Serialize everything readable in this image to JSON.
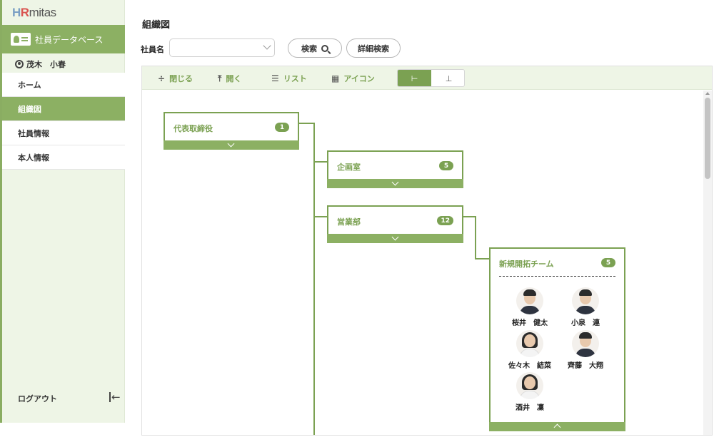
{
  "sidebar": {
    "logo": {
      "h": "H",
      "r": "R",
      "rest": "mitas"
    },
    "database_label": "社員データベース",
    "user_name": "茂木　小春",
    "nav": [
      {
        "label": "ホーム"
      },
      {
        "label": "組織図"
      },
      {
        "label": "社員情報"
      },
      {
        "label": "本人情報"
      }
    ],
    "logout_label": "ログアウト",
    "collapse_glyph": "←"
  },
  "main": {
    "title": "組織図",
    "search": {
      "label": "社員名",
      "placeholder": "",
      "search_button": "検索",
      "advanced_button": "詳細検索"
    },
    "toolbar": {
      "close_label": "閉じる",
      "open_label": "開く",
      "list_label": "リスト",
      "icon_label": "アイコン",
      "close_icon": "÷",
      "open_icon": "⤒",
      "list_icon": "☰",
      "icon_icon": "▦",
      "view_tree_icon": "⊢",
      "view_org_icon": "⊥"
    },
    "org": {
      "root": {
        "name": "代表取締役",
        "count": "1"
      },
      "planning": {
        "name": "企画室",
        "count": "5"
      },
      "sales": {
        "name": "営業部",
        "count": "12"
      },
      "team": {
        "name": "新規開拓チーム",
        "count": "5",
        "members": [
          {
            "name": "桜井　健太",
            "gender": "male"
          },
          {
            "name": "小泉　連",
            "gender": "male"
          },
          {
            "name": "佐々木　結菜",
            "gender": "female"
          },
          {
            "name": "齊藤　大翔",
            "gender": "male"
          },
          {
            "name": "酒井　凜",
            "gender": "female"
          }
        ]
      }
    }
  },
  "colors": {
    "accent": "#7ba152",
    "accent_light": "#eef5e6",
    "active_nav": "#8cb063"
  }
}
